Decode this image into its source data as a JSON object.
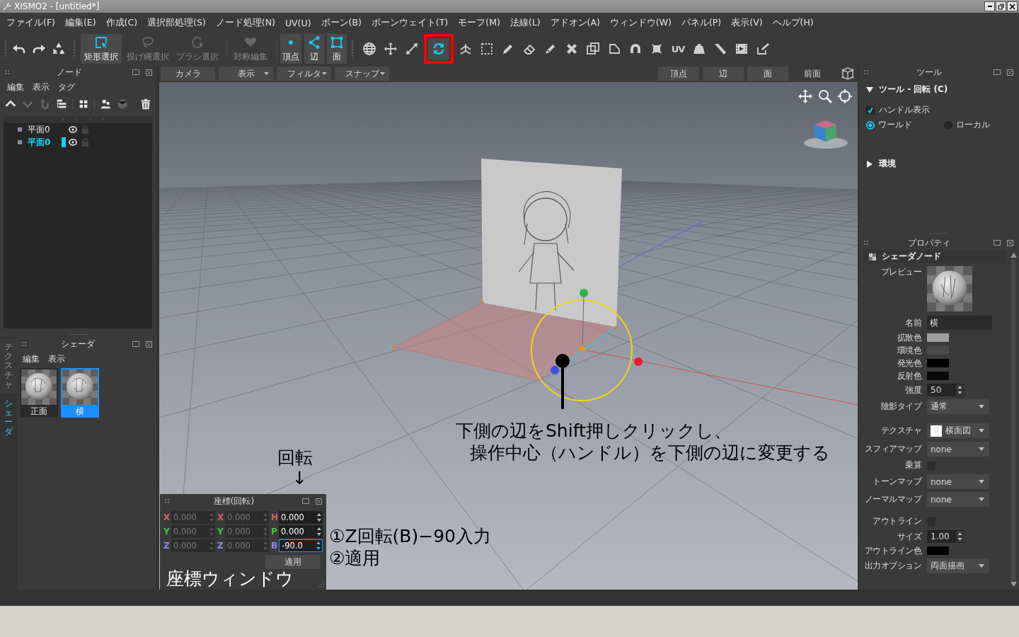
{
  "window": {
    "title": "XISMO2 - [untitled*]"
  },
  "menu": [
    "ファイル(F)",
    "編集(E)",
    "作成(C)",
    "選択部処理(S)",
    "ノード処理(N)",
    "UV(U)",
    "ボーン(B)",
    "ボーンウェイト(T)",
    "モーフ(M)",
    "法線(L)",
    "アドオン(A)",
    "ウィンドウ(W)",
    "パネル(P)",
    "表示(V)",
    "ヘルプ(H)"
  ],
  "toolbar": {
    "select_modes": [
      {
        "label": "矩形選択",
        "selected": true,
        "disabled": false
      },
      {
        "label": "投げ縄選択",
        "selected": false,
        "disabled": true
      },
      {
        "label": "ブラシ選択",
        "selected": false,
        "disabled": true
      },
      {
        "label": "対称編集",
        "selected": false,
        "disabled": true
      }
    ],
    "elements": [
      {
        "label": "頂点",
        "selected": true
      },
      {
        "label": "辺",
        "selected": true
      },
      {
        "label": "面",
        "selected": true
      }
    ],
    "tools": [
      {
        "selected": false,
        "marked": false
      },
      {
        "selected": false,
        "marked": false
      },
      {
        "selected": false,
        "marked": false
      },
      {
        "selected": true,
        "marked": true
      },
      {
        "selected": false,
        "marked": false
      },
      {
        "selected": false,
        "marked": false
      },
      {
        "selected": false,
        "marked": false
      },
      {
        "selected": false,
        "marked": false
      },
      {
        "selected": false,
        "marked": false
      },
      {
        "selected": false,
        "marked": false
      },
      {
        "selected": false,
        "marked": false
      },
      {
        "selected": false,
        "marked": false
      },
      {
        "selected": false,
        "marked": false
      },
      {
        "selected": false,
        "marked": false
      },
      {
        "selected": false,
        "marked": false,
        "text": "UV"
      },
      {
        "selected": false,
        "marked": false
      },
      {
        "selected": false,
        "marked": false
      },
      {
        "selected": false,
        "marked": false
      },
      {
        "selected": false,
        "marked": false
      }
    ]
  },
  "node_panel": {
    "title": "ノード",
    "menu": [
      "編集",
      "表示",
      "タグ"
    ],
    "tools": [
      {
        "disabled": false
      },
      {
        "disabled": true
      },
      {
        "disabled": true
      },
      {
        "disabled": false
      },
      {
        "disabled": false
      },
      {
        "disabled": false
      },
      {
        "disabled": true
      },
      {
        "disabled": false
      }
    ],
    "items": [
      {
        "label": "平面0",
        "selected": false,
        "locked": false
      },
      {
        "label": "平面0",
        "selected": true,
        "locked": false
      }
    ]
  },
  "side_tabs": [
    {
      "label": "テクスチャ",
      "selected": false
    },
    {
      "label": "シェーダ",
      "selected": true
    }
  ],
  "shader_panel": {
    "title": "シェーダ",
    "menu": [
      "編集",
      "表示"
    ],
    "items": [
      {
        "label": "正面",
        "selected": false
      },
      {
        "label": "横",
        "selected": true
      }
    ]
  },
  "viewport": {
    "bar_left": [
      {
        "label": "カメラ",
        "kind": "button"
      },
      {
        "label": "表示",
        "kind": "dropdown"
      },
      {
        "label": "フィルタ",
        "kind": "dropdown"
      },
      {
        "label": "スナップ",
        "kind": "dropdown"
      }
    ],
    "bar_right": [
      {
        "label": "頂点",
        "kind": "button"
      },
      {
        "label": "辺",
        "kind": "button"
      },
      {
        "label": "面",
        "kind": "button"
      },
      {
        "label": "前面",
        "kind": "label"
      }
    ],
    "annotations": [
      {
        "text": "下側の辺をShift押しクリックし、"
      },
      {
        "text": "回転"
      },
      {
        "text": "操作中心（ハンドル）を下側の辺に変更する"
      },
      {
        "text": "↓"
      },
      {
        "text": "①Z回転(B)−90入力"
      },
      {
        "text": "②適用"
      },
      {
        "text": "座標ウィンドウ"
      }
    ]
  },
  "coord_window": {
    "title": "座標(回転)",
    "columns": [
      [
        {
          "axis": "X",
          "color": "#e05a5a",
          "value": "0.000",
          "disabled": true,
          "focused": false
        },
        {
          "axis": "Y",
          "color": "#3cc83c",
          "value": "0.000",
          "disabled": true,
          "focused": false
        },
        {
          "axis": "Z",
          "color": "#8a8aff",
          "value": "0.000",
          "disabled": true,
          "focused": false
        }
      ],
      [
        {
          "axis": "X",
          "color": "#e05a5a",
          "value": "0.000",
          "disabled": true,
          "focused": false
        },
        {
          "axis": "Y",
          "color": "#3cc83c",
          "value": "0.000",
          "disabled": true,
          "focused": false
        },
        {
          "axis": "Z",
          "color": "#8a8aff",
          "value": "0.000",
          "disabled": true,
          "focused": false
        }
      ],
      [
        {
          "axis": "H",
          "color": "#e05a5a",
          "value": "0.000",
          "disabled": false,
          "focused": false
        },
        {
          "axis": "P",
          "color": "#3cc83c",
          "value": "0.000",
          "disabled": false,
          "focused": false
        },
        {
          "axis": "B",
          "color": "#8a8aff",
          "value": "-90.0",
          "disabled": false,
          "focused": true
        }
      ]
    ],
    "apply": "適用"
  },
  "tool_panel": {
    "title": "ツール",
    "sections": [
      {
        "title": "ツール - 回転 (C)",
        "expanded": true
      },
      {
        "title": "環境",
        "expanded": false
      }
    ],
    "handle": {
      "label": "ハンドル表示",
      "checked": true
    },
    "space": [
      {
        "label": "ワールド",
        "selected": true
      },
      {
        "label": "ローカル",
        "selected": false
      }
    ]
  },
  "properties": {
    "title": "プロパティ",
    "section": "シェーダノード",
    "rows": [
      {
        "kind": "preview",
        "label": "プレビュー"
      },
      {
        "kind": "text",
        "label": "名前",
        "value": "横"
      },
      {
        "kind": "color",
        "label": "拡散色",
        "color": "#a0a0a0"
      },
      {
        "kind": "color",
        "label": "環境色",
        "color": "#4a4a4a"
      },
      {
        "kind": "color",
        "label": "発光色",
        "color": "#000000"
      },
      {
        "kind": "color",
        "label": "反射色",
        "color": "#0a0a0a"
      },
      {
        "kind": "spin",
        "label": "強度",
        "value": "50"
      },
      {
        "kind": "select",
        "label": "陰影タイプ",
        "value": "通常"
      },
      {
        "kind": "texture",
        "label": "テクスチャ",
        "value": "横面図"
      },
      {
        "kind": "select",
        "label": "スフィアマップ",
        "value": "none"
      },
      {
        "kind": "check",
        "label": "乗算",
        "checked": false
      },
      {
        "kind": "select",
        "label": "トーンマップ",
        "value": "none"
      },
      {
        "kind": "select",
        "label": "ノーマルマップ",
        "value": "none"
      },
      {
        "kind": "check",
        "label": "アウトライン",
        "checked": false
      },
      {
        "kind": "spin",
        "label": "サイズ",
        "value": "1.00"
      },
      {
        "kind": "color",
        "label": "アウトライン色",
        "color": "#000000"
      },
      {
        "kind": "select",
        "label": "出力オプション",
        "value": "両面描画"
      }
    ]
  }
}
